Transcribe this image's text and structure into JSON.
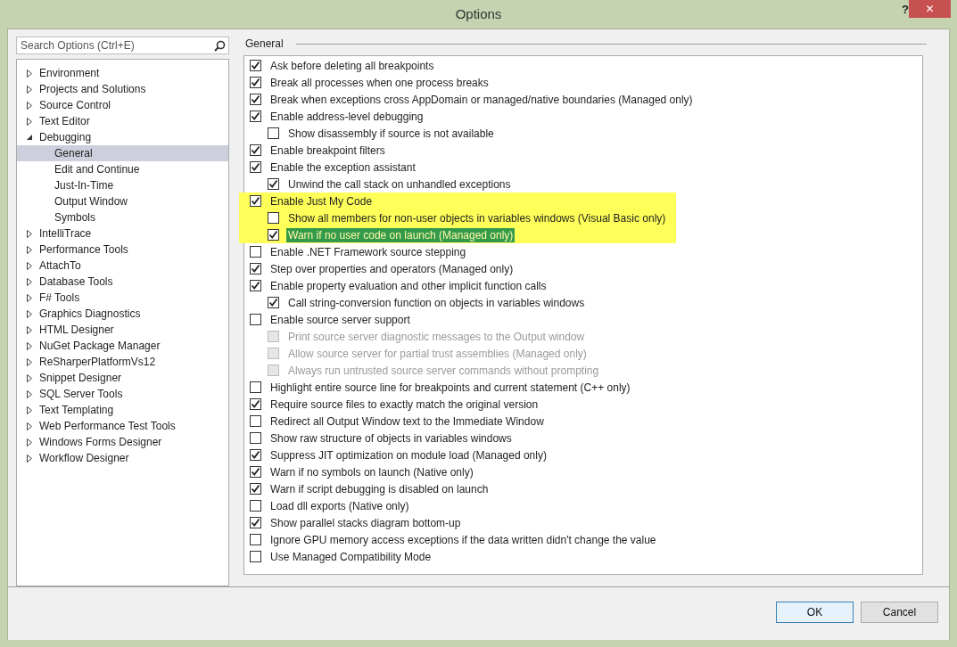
{
  "window": {
    "title": "Options",
    "help": "?",
    "close": "✕"
  },
  "search": {
    "placeholder": "Search Options (Ctrl+E)"
  },
  "tree": [
    {
      "label": "Environment",
      "expanded": false,
      "selected": false
    },
    {
      "label": "Projects and Solutions",
      "expanded": false,
      "selected": false
    },
    {
      "label": "Source Control",
      "expanded": false,
      "selected": false
    },
    {
      "label": "Text Editor",
      "expanded": false,
      "selected": false
    },
    {
      "label": "Debugging",
      "expanded": true,
      "selected": false,
      "children": [
        {
          "label": "General",
          "selected": true
        },
        {
          "label": "Edit and Continue",
          "selected": false
        },
        {
          "label": "Just-In-Time",
          "selected": false
        },
        {
          "label": "Output Window",
          "selected": false
        },
        {
          "label": "Symbols",
          "selected": false
        }
      ]
    },
    {
      "label": "IntelliTrace",
      "expanded": false,
      "selected": false
    },
    {
      "label": "Performance Tools",
      "expanded": false,
      "selected": false
    },
    {
      "label": "AttachTo",
      "expanded": false,
      "selected": false
    },
    {
      "label": "Database Tools",
      "expanded": false,
      "selected": false
    },
    {
      "label": "F# Tools",
      "expanded": false,
      "selected": false
    },
    {
      "label": "Graphics Diagnostics",
      "expanded": false,
      "selected": false
    },
    {
      "label": "HTML Designer",
      "expanded": false,
      "selected": false
    },
    {
      "label": "NuGet Package Manager",
      "expanded": false,
      "selected": false
    },
    {
      "label": "ReSharperPlatformVs12",
      "expanded": false,
      "selected": false
    },
    {
      "label": "Snippet Designer",
      "expanded": false,
      "selected": false
    },
    {
      "label": "SQL Server Tools",
      "expanded": false,
      "selected": false
    },
    {
      "label": "Text Templating",
      "expanded": false,
      "selected": false
    },
    {
      "label": "Web Performance Test Tools",
      "expanded": false,
      "selected": false
    },
    {
      "label": "Windows Forms Designer",
      "expanded": false,
      "selected": false
    },
    {
      "label": "Workflow Designer",
      "expanded": false,
      "selected": false
    }
  ],
  "section": {
    "title": "General"
  },
  "options": [
    {
      "label": "Ask before deleting all breakpoints",
      "checked": true,
      "disabled": false,
      "selected": false,
      "highlighted": false
    },
    {
      "label": "Break all processes when one process breaks",
      "checked": true,
      "disabled": false,
      "selected": false,
      "highlighted": false
    },
    {
      "label": "Break when exceptions cross AppDomain or managed/native boundaries (Managed only)",
      "checked": true,
      "disabled": false,
      "selected": false,
      "highlighted": false
    },
    {
      "label": "Enable address-level debugging",
      "checked": true,
      "disabled": false,
      "selected": false,
      "highlighted": false,
      "children": [
        {
          "label": "Show disassembly if source is not available",
          "checked": false,
          "disabled": false,
          "selected": false
        }
      ]
    },
    {
      "label": "Enable breakpoint filters",
      "checked": true,
      "disabled": false,
      "selected": false,
      "highlighted": false
    },
    {
      "label": "Enable the exception assistant",
      "checked": true,
      "disabled": false,
      "selected": false,
      "highlighted": false,
      "children": [
        {
          "label": "Unwind the call stack on unhandled exceptions",
          "checked": true,
          "disabled": false,
          "selected": false
        }
      ]
    },
    {
      "label": "Enable Just My Code",
      "checked": true,
      "disabled": false,
      "selected": false,
      "highlighted": true,
      "children": [
        {
          "label": "Show all members for non-user objects in variables windows (Visual Basic only)",
          "checked": false,
          "disabled": false,
          "selected": false
        },
        {
          "label": "Warn if no user code on launch (Managed only)",
          "checked": true,
          "disabled": false,
          "selected": true
        }
      ]
    },
    {
      "label": "Enable .NET Framework source stepping",
      "checked": false,
      "disabled": false,
      "selected": false,
      "highlighted": false
    },
    {
      "label": "Step over properties and operators (Managed only)",
      "checked": true,
      "disabled": false,
      "selected": false,
      "highlighted": false
    },
    {
      "label": "Enable property evaluation and other implicit function calls",
      "checked": true,
      "disabled": false,
      "selected": false,
      "highlighted": false,
      "children": [
        {
          "label": "Call string-conversion function on objects in variables windows",
          "checked": true,
          "disabled": false,
          "selected": false
        }
      ]
    },
    {
      "label": "Enable source server support",
      "checked": false,
      "disabled": false,
      "selected": false,
      "highlighted": false,
      "children": [
        {
          "label": "Print source server diagnostic messages to the Output window",
          "checked": false,
          "disabled": true,
          "selected": false
        },
        {
          "label": "Allow source server for partial trust assemblies (Managed only)",
          "checked": false,
          "disabled": true,
          "selected": false
        },
        {
          "label": "Always run untrusted source server commands without prompting",
          "checked": false,
          "disabled": true,
          "selected": false
        }
      ]
    },
    {
      "label": "Highlight entire source line for breakpoints and current statement (C++ only)",
      "checked": false,
      "disabled": false,
      "selected": false,
      "highlighted": false
    },
    {
      "label": "Require source files to exactly match the original version",
      "checked": true,
      "disabled": false,
      "selected": false,
      "highlighted": false
    },
    {
      "label": "Redirect all Output Window text to the Immediate Window",
      "checked": false,
      "disabled": false,
      "selected": false,
      "highlighted": false
    },
    {
      "label": "Show raw structure of objects in variables windows",
      "checked": false,
      "disabled": false,
      "selected": false,
      "highlighted": false
    },
    {
      "label": "Suppress JIT optimization on module load (Managed only)",
      "checked": true,
      "disabled": false,
      "selected": false,
      "highlighted": false
    },
    {
      "label": "Warn if no symbols on launch (Native only)",
      "checked": true,
      "disabled": false,
      "selected": false,
      "highlighted": false
    },
    {
      "label": "Warn if script debugging is disabled on launch",
      "checked": true,
      "disabled": false,
      "selected": false,
      "highlighted": false
    },
    {
      "label": "Load dll exports (Native only)",
      "checked": false,
      "disabled": false,
      "selected": false,
      "highlighted": false
    },
    {
      "label": "Show parallel stacks diagram bottom-up",
      "checked": true,
      "disabled": false,
      "selected": false,
      "highlighted": false
    },
    {
      "label": "Ignore GPU memory access exceptions if the data written didn't change the value",
      "checked": false,
      "disabled": false,
      "selected": false,
      "highlighted": false
    },
    {
      "label": "Use Managed Compatibility Mode",
      "checked": false,
      "disabled": false,
      "selected": false,
      "highlighted": false
    }
  ],
  "buttons": [
    "OK",
    "Cancel"
  ]
}
